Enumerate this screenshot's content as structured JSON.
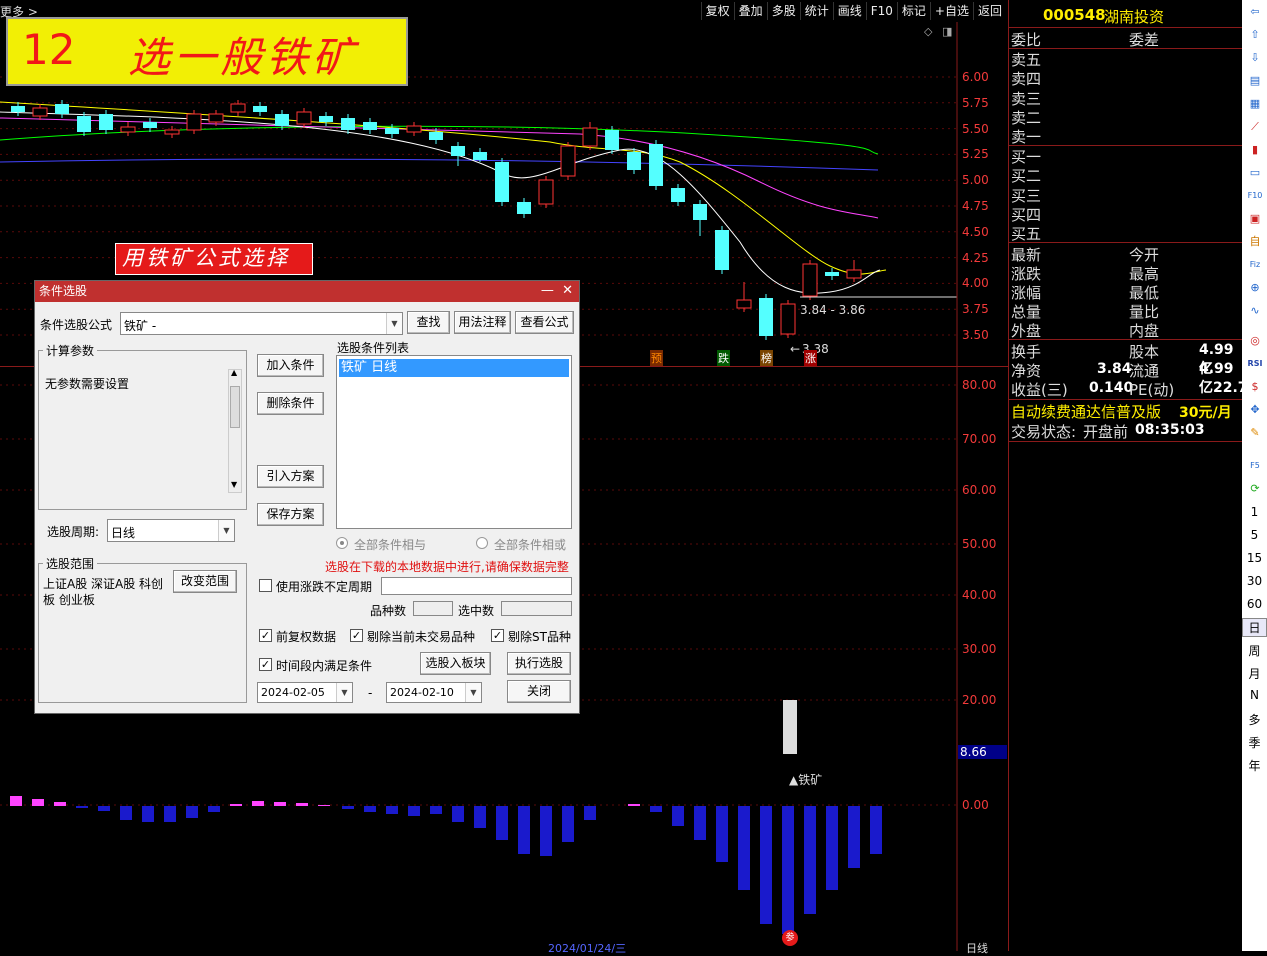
{
  "toolbar": {
    "more": "更多 >",
    "buttons": [
      "复权",
      "叠加",
      "多股",
      "统计",
      "画线",
      "F10",
      "标记",
      "+自选",
      "返回"
    ]
  },
  "overlay": {
    "number": "12",
    "title": "选一般铁矿",
    "formula_label": "用铁矿公式选择"
  },
  "price_axis": [
    "6.00",
    "5.75",
    "5.50",
    "5.25",
    "5.00",
    "4.75",
    "4.50",
    "4.25",
    "4.00",
    "3.75",
    "3.50"
  ],
  "indicator_axis": [
    "80.00",
    "70.00",
    "60.00",
    "50.00",
    "40.00",
    "30.00",
    "20.00",
    "0.00"
  ],
  "chart_labels": {
    "range": "3.84 - 3.86",
    "low": "3.38",
    "current": "8.66",
    "marker": "▲铁矿",
    "tags": [
      "预",
      "跌",
      "榜",
      "涨"
    ],
    "bottom_tag": "参",
    "date": "2024/01/24/三",
    "period": "日线"
  },
  "colors": {
    "up": "#ff3333",
    "down": "#54ffff",
    "ma5": "#ffffff",
    "ma10": "#ffff00",
    "ma20": "#ff44ff",
    "ma30": "#00ff00",
    "ma60": "#4444ff",
    "accent": "#f23a3a"
  },
  "right_panel": {
    "code": "000548",
    "name": "湖南投资",
    "header_left": "委比",
    "header_right": "委差",
    "sell": [
      "卖五",
      "卖四",
      "卖三",
      "卖二",
      "卖一"
    ],
    "buy": [
      "买一",
      "买二",
      "买三",
      "买四",
      "买五"
    ],
    "stats_left": [
      "最新",
      "涨跌",
      "涨幅",
      "总量",
      "外盘"
    ],
    "stats_right": [
      "今开",
      "最高",
      "最低",
      "量比",
      "内盘"
    ],
    "turnover": "换手",
    "share_cap": "股本",
    "share_cap_val": "4.99亿",
    "net_asset": "净资",
    "net_asset_val": "3.84",
    "float": "流通",
    "float_val": "4.99亿",
    "eps": "收益(三)",
    "eps_val": "0.140",
    "pe": "PE(动)",
    "pe_val": "22.7",
    "promo": "自动续费通达信普及版",
    "promo_price": "30元/月",
    "status_label": "交易状态:",
    "status_val": "开盘前",
    "status_time": "08:35:03"
  },
  "sidebar": {
    "periods": [
      "1",
      "5",
      "15",
      "30",
      "60",
      "日",
      "周",
      "月",
      "N",
      "多",
      "季",
      "年"
    ]
  },
  "dialog": {
    "title": "条件选股",
    "formula_label": "条件选股公式",
    "formula_value": "铁矿  -",
    "find_btn": "查找",
    "usage_btn": "用法注释",
    "view_btn": "查看公式",
    "params_title": "计算参数",
    "params_text": "无参数需要设置",
    "period_label": "选股周期:",
    "period_value": "日线",
    "add_btn": "加入条件",
    "del_btn": "删除条件",
    "import_btn": "引入方案",
    "save_btn": "保存方案",
    "list_title": "选股条件列表",
    "list_items": [
      "铁矿  日线"
    ],
    "and_label": "全部条件相与",
    "or_label": "全部条件相或",
    "warning": "选股在下载的本地数据中进行,请确保数据完整",
    "range_title": "选股范围",
    "range_text": "上证A股 深证A股 科创板 创业板",
    "change_range_btn": "改变范围",
    "unfixed_label": "使用涨跌不定周期",
    "count_label": "品种数",
    "selected_label": "选中数",
    "fq_label": "前复权数据",
    "exclude_label": "剔除当前未交易品种",
    "st_label": "剔除ST品种",
    "time_label": "时间段内满足条件",
    "to_block_btn": "选股入板块",
    "exec_btn": "执行选股",
    "date_from": "2024-02-05",
    "date_sep": "-",
    "date_to": "2024-02-10",
    "close_btn": "关闭"
  }
}
